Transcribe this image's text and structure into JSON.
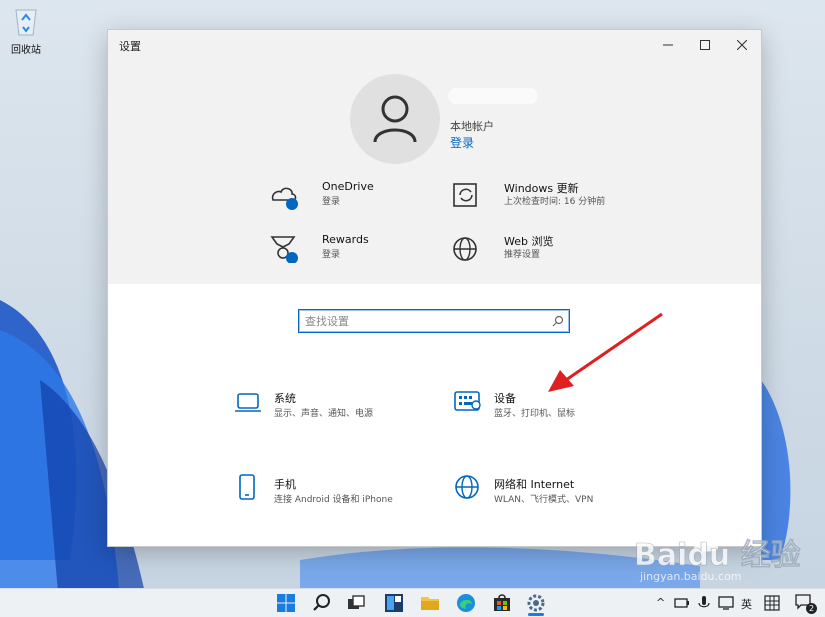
{
  "desktop": {
    "recycle_bin_label": "回收站"
  },
  "window": {
    "title": "设置",
    "minimize_icon": "minimize-icon",
    "maximize_icon": "maximize-icon",
    "close_icon": "close-icon"
  },
  "account": {
    "type": "本地帐户",
    "login_link": "登录"
  },
  "tiles": [
    {
      "icon": "onedrive-icon",
      "title": "OneDrive",
      "subtitle": "登录"
    },
    {
      "icon": "windows-update-icon",
      "title": "Windows 更新",
      "subtitle": "上次检查时间: 16 分钟前"
    },
    {
      "icon": "rewards-icon",
      "title": "Rewards",
      "subtitle": "登录"
    },
    {
      "icon": "globe-icon",
      "title": "Web 浏览",
      "subtitle": "推荐设置"
    }
  ],
  "search": {
    "placeholder": "查找设置"
  },
  "categories": [
    {
      "icon": "laptop-icon",
      "title": "系统",
      "subtitle": "显示、声音、通知、电源"
    },
    {
      "icon": "keyboard-icon",
      "title": "设备",
      "subtitle": "蓝牙、打印机、鼠标"
    },
    {
      "icon": "phone-icon",
      "title": "手机",
      "subtitle": "连接 Android 设备和 iPhone"
    },
    {
      "icon": "network-globe-icon",
      "title": "网络和 Internet",
      "subtitle": "WLAN、飞行模式、VPN"
    }
  ],
  "taskbar": {
    "ime_label": "英",
    "notification_count": "2"
  },
  "colors": {
    "accent": "#0067c0",
    "arrow": "#e02020",
    "wallpaper_blue": "#1a5fd6"
  }
}
